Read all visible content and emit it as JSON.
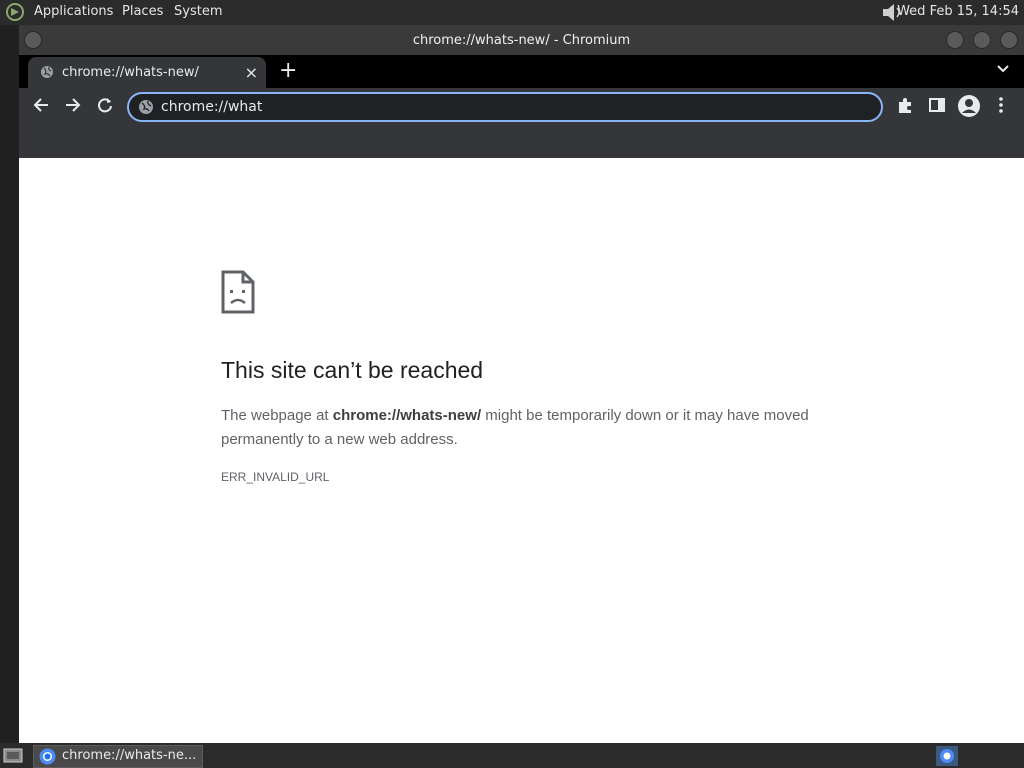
{
  "top_panel": {
    "menus": [
      "Applications",
      "Places",
      "System"
    ],
    "clock": "Wed Feb 15, 14:54"
  },
  "window": {
    "title": "chrome://whats-new/ - Chromium"
  },
  "tab": {
    "label": "chrome://whats-new/",
    "close": "×",
    "new_tab": "+"
  },
  "omnibox": {
    "value": "chrome://what"
  },
  "error_page": {
    "heading": "This site can’t be reached",
    "desc_prefix": "The webpage at ",
    "desc_url": "chrome://whats-new/",
    "desc_suffix": " might be temporarily down or it may have moved permanently to a new web address.",
    "error_code": "ERR_INVALID_URL"
  },
  "taskbar": {
    "item_label": "chrome://whats-ne..."
  },
  "colors": {
    "focus_ring": "#8ab4f8",
    "page_bg": "#ffffff",
    "toolbar_bg": "#35363a"
  }
}
